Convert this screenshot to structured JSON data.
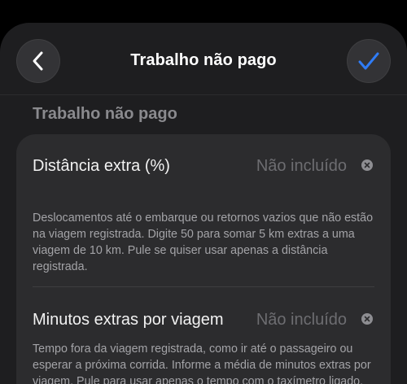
{
  "nav": {
    "title": "Trabalho não pago",
    "back_icon": "chevron-left-icon",
    "confirm_icon": "checkmark-icon",
    "accent_color": "#2f7cf6"
  },
  "section": {
    "title": "Trabalho não pago"
  },
  "fields": [
    {
      "label": "Distância extra (%)",
      "value_placeholder": "Não incluído",
      "description": "Deslocamentos até o embarque ou retornos vazios que não estão na viagem registrada. Digite 50 para somar 5 km extras a uma viagem de 10 km. Pule se quiser usar apenas a distância registrada."
    },
    {
      "label": "Minutos extras por viagem",
      "value_placeholder": "Não incluído",
      "description": "Tempo fora da viagem registrada, como ir até o passageiro ou esperar a próxima corrida. Informe a média de minutos extras por viagem. Pule para usar apenas o tempo com o taxímetro ligado."
    }
  ]
}
